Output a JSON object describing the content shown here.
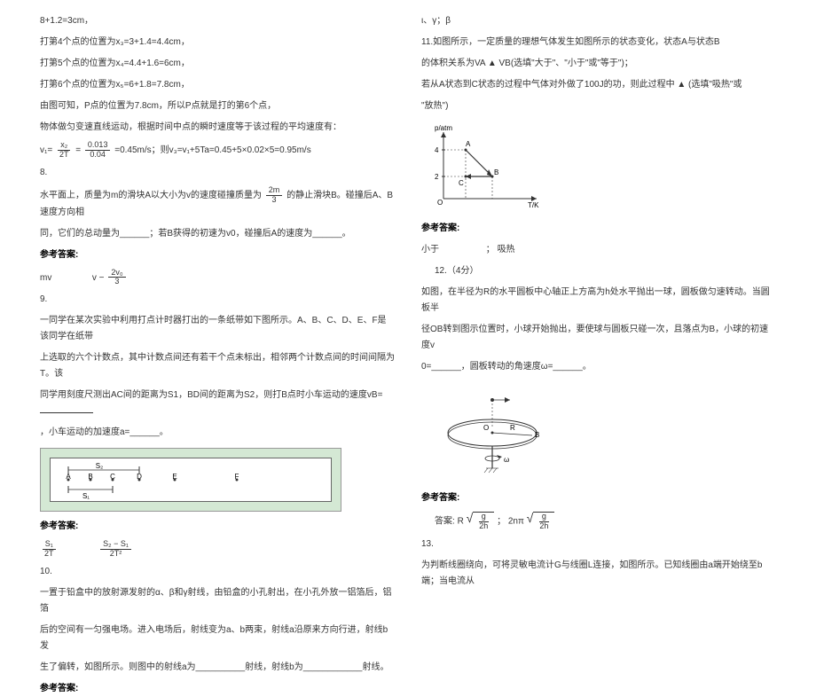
{
  "left": {
    "l1": "8+1.2=3cm，",
    "l2": "打第4个点的位置为x₃=3+1.4=4.4cm，",
    "l3": "打第5个点的位置为x₄=4.4+1.6=6cm，",
    "l4": "打第6个点的位置为x₅=6+1.8=7.8cm，",
    "l5": "由图可知，P点的位置为7.8cm，所以P点就是打的第6个点，",
    "l6": "物体做匀变速直线运动，根据时间中点的瞬时速度等于该过程的平均速度有：",
    "l7a": "v₁=",
    "l7frac_n": "x₂",
    "l7frac_d": "2T",
    "l7b": "=",
    "l7frac2_n": "0.013",
    "l7frac2_d": "0.04",
    "l7c": "=0.45m/s；则v₃=v₁+5Ta=0.45+5×0.02×5=0.95m/s",
    "q8": "8.",
    "l8a": "水平面上，质量为m的滑块A以大小为v的速度碰撞质量为",
    "l8frac_n": "2m",
    "l8frac_d": "3",
    "l8b": "的静止滑块B。碰撞后A、B速度方向相",
    "l8c": "同，它们的总动量为______；若B获得的初速为v0，碰撞后A的速度为______。",
    "ans_label": "参考答案:",
    "ans8a": "mv",
    "ans8b_pre": "v −",
    "ans8b_n": "2v₀",
    "ans8b_d": "3",
    "q9": "9.",
    "l9a": "一同学在某次实验中利用打点计时器打出的一条纸带如下图所示。A、B、C、D、E、F是该同学在纸带",
    "l9b": "上选取的六个计数点，其中计数点间还有若干个点未标出，相邻两个计数点间的时间间隔为T。该",
    "l9c": "同学用刻度尺测出AC间的距离为S1，BD间的距离为S2，则打B点时小车运动的速度vB=",
    "l9d": "，小车运动的加速度a=______。",
    "tape_labels": {
      "A": "A",
      "B": "B",
      "C": "C",
      "D": "D",
      "E": "E",
      "F": "F",
      "S1": "S₁",
      "S2": "S₂"
    },
    "ans9a_n": "S₁",
    "ans9a_d": "2T",
    "ans9b_n": "S₂ − S₁",
    "ans9b_d": "2T²",
    "q10": "10.",
    "l10a": "一置于铅盒中的放射源发射的α、β和γ射线，由铅盒的小孔射出，在小孔外放一铝箔后，铝箔",
    "l10b": "后的空间有一匀强电场。进入电场后，射线变为a、b两束，射线a沿原来方向行进，射线b发",
    "l10c": "生了偏转，如图所示。则图中的射线a为__________射线，射线b为____________射线。",
    "ans10": "ι、γ；β"
  },
  "right": {
    "l11a": "11.如图所示，一定质量的理想气体发生如图所示的状态变化，状态A与状态B",
    "l11b": "的体积关系为VA    ▲  VB(选填\"大于\"、\"小于\"或\"等于\")；",
    "l11c": "若从A状态到C状态的过程中气体对外做了100J的功，则此过程中     ▲     (选填\"吸热\"或",
    "l11d": "\"放热\")",
    "graph": {
      "ylabel": "p/atm",
      "xlabel": "T/K",
      "A": "A",
      "B": "B",
      "C": "C",
      "y4": "4",
      "y2": "2",
      "O": "O"
    },
    "ans11a": "小于",
    "ans11b": "吸热",
    "q12": "12.（4分）",
    "l12a": "如图，在半径为R的水平圆板中心轴正上方高为h处水平抛出一球，圆板做匀速转动。当圆板半",
    "l12b": "径OB转到图示位置时，小球开始抛出，要使球与圆板只碰一次，且落点为B，小球的初速度v",
    "l12c": "0=______，圆板转动的角速度ω=______。",
    "disk": {
      "O": "O",
      "R": "R",
      "B": "B",
      "omega": "ω"
    },
    "ans12_label": "答案:",
    "ans12_v_pre": "R",
    "ans12_v_n": "g",
    "ans12_v_d": "2h",
    "ans12_sep": "；  2nπ",
    "ans12_w_n": "g",
    "ans12_w_d": "2h",
    "q13": "13.",
    "l13a": "为判断线圈绕向，可将灵敏电流计G与线圈L连接，如图所示。已知线圈由a端开始绕至b端；当电流从"
  }
}
